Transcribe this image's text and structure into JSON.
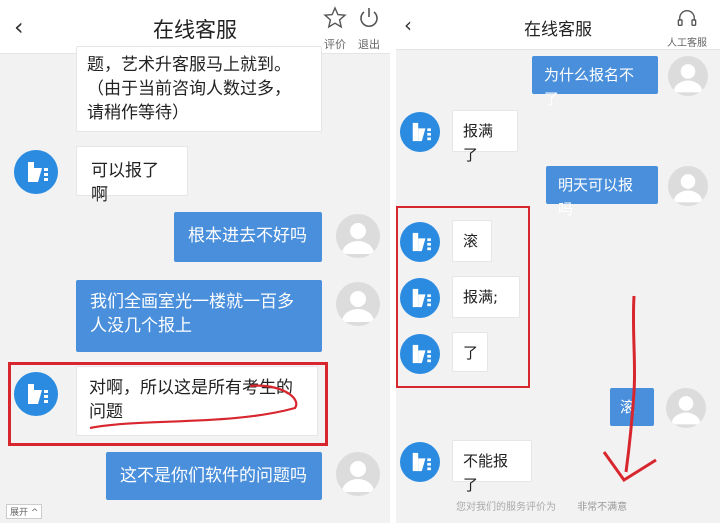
{
  "left": {
    "title": "在线客服",
    "back_icon": "‹",
    "btn_rate": "评价",
    "btn_exit": "退出",
    "messages": [
      {
        "from": "cs",
        "lines": [
          "题，艺术升客服马上就到。",
          "（由于当前咨询人数过多，",
          "请稍作等待）"
        ]
      },
      {
        "from": "cs",
        "lines": [
          "可以报了啊"
        ]
      },
      {
        "from": "me",
        "lines": [
          "根本进去不好吗"
        ]
      },
      {
        "from": "me",
        "lines": [
          "我们全画室光一楼就一百多",
          "人没几个报上"
        ]
      },
      {
        "from": "cs",
        "lines": [
          "对啊，所以这是所有考生的",
          "问题"
        ]
      },
      {
        "from": "me",
        "lines": [
          "这不是你们软件的问题吗"
        ]
      }
    ],
    "footer_tag": "展开 ^"
  },
  "right": {
    "title": "在线客服",
    "back_icon": "‹",
    "btn_human": "人工客服",
    "messages": [
      {
        "from": "me",
        "lines": [
          "为什么报名不了"
        ]
      },
      {
        "from": "cs",
        "lines": [
          "报满了"
        ]
      },
      {
        "from": "me",
        "lines": [
          "明天可以报吗"
        ]
      },
      {
        "from": "cs",
        "lines": [
          "滚"
        ]
      },
      {
        "from": "cs",
        "lines": [
          "报满;"
        ]
      },
      {
        "from": "cs",
        "lines": [
          "了"
        ]
      },
      {
        "from": "me",
        "lines": [
          "滚"
        ]
      },
      {
        "from": "cs",
        "lines": [
          "不能报了"
        ]
      }
    ],
    "rating_prompt": "您对我们的服务评价为",
    "rating_option": "非常不满意"
  },
  "colors": {
    "accent": "#4a8fdb",
    "avatar": "#2a8be0",
    "annotation": "#d8262e"
  }
}
